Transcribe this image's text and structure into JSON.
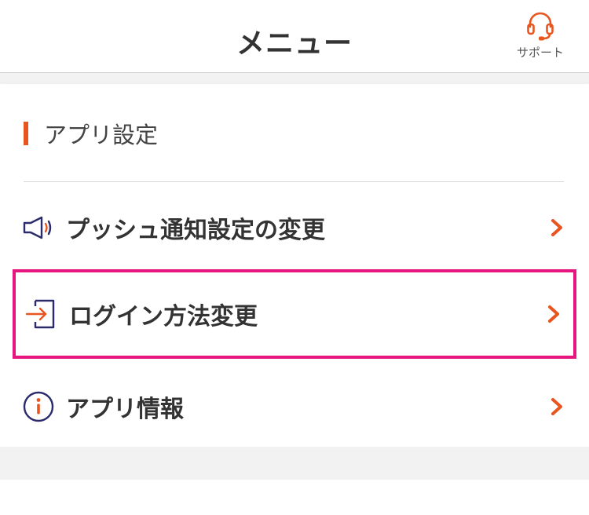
{
  "header": {
    "title": "メニュー",
    "support_label": "サポート"
  },
  "section": {
    "title": "アプリ設定"
  },
  "menu": {
    "items": [
      {
        "label": "プッシュ通知設定の変更",
        "icon": "megaphone-icon",
        "highlighted": false
      },
      {
        "label": "ログイン方法変更",
        "icon": "login-icon",
        "highlighted": true
      },
      {
        "label": "アプリ情報",
        "icon": "info-icon",
        "highlighted": false
      }
    ]
  },
  "colors": {
    "accent": "#e8551f",
    "highlight_border": "#e6157f",
    "icon_navy": "#2b2b6b",
    "text": "#333333"
  }
}
